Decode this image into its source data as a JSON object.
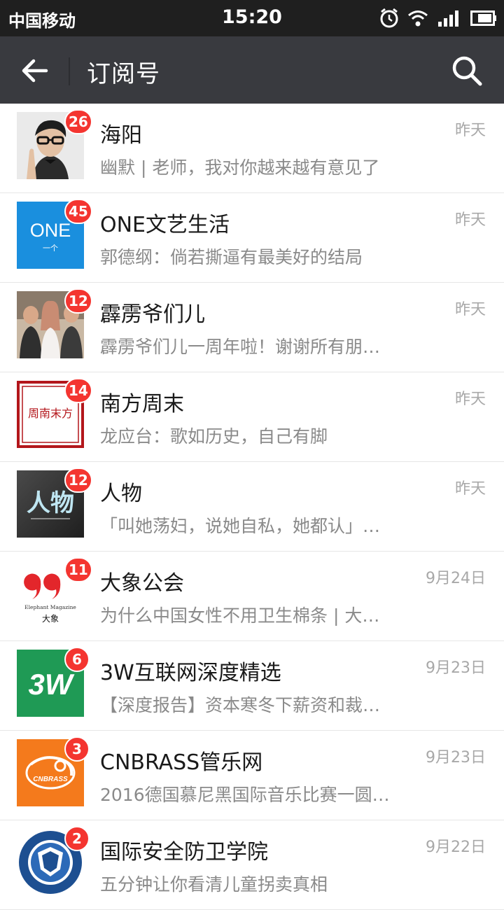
{
  "status_bar": {
    "carrier": "中国移动",
    "time": "15:20",
    "icons": [
      "alarm-icon",
      "wifi-icon",
      "signal-icon",
      "battery-icon"
    ]
  },
  "nav": {
    "title": "订阅号",
    "back_icon": "arrow-left-icon",
    "search_icon": "search-icon"
  },
  "colors": {
    "nav_bg": "#393a3f",
    "status_bg": "#1f1f1f",
    "badge": "#f43530"
  },
  "items": [
    {
      "name": "海阳",
      "preview": "幽默 | 老师，我对你越来越有意见了",
      "time": "昨天",
      "badge": "26"
    },
    {
      "name": "ONE文艺生活",
      "preview": "郭德纲：倘若撕逼有最美好的结局",
      "time": "昨天",
      "badge": "45",
      "avatar_text": "ONE",
      "avatar_sub": "一个"
    },
    {
      "name": "霹雳爷们儿",
      "preview": "霹雳爷们儿一周年啦！谢谢所有朋…",
      "time": "昨天",
      "badge": "12"
    },
    {
      "name": "南方周末",
      "preview": "龙应台：歌如历史，自己有脚",
      "time": "昨天",
      "badge": "14",
      "avatar_text": "周南末方"
    },
    {
      "name": "人物",
      "preview": "「叫她荡妇，说她自私，她都认」…",
      "time": "昨天",
      "badge": "12",
      "avatar_text": "人物"
    },
    {
      "name": "大象公会",
      "preview": "为什么中国女性不用卫生棉条 | 大…",
      "time": "9月24日",
      "badge": "11",
      "avatar_text": "Elephant Magazine",
      "avatar_sub": "大象"
    },
    {
      "name": "3W互联网深度精选",
      "preview": "【深度报告】资本寒冬下薪资和裁…",
      "time": "9月23日",
      "badge": "6",
      "avatar_text": "3W"
    },
    {
      "name": "CNBRASS管乐网",
      "preview": "2016德国慕尼黑国际音乐比赛一圆…",
      "time": "9月23日",
      "badge": "3",
      "avatar_text": "CNBRASS"
    },
    {
      "name": "国际安全防卫学院",
      "preview": "五分钟让你看清儿童拐卖真相",
      "time": "9月22日",
      "badge": "2"
    }
  ]
}
